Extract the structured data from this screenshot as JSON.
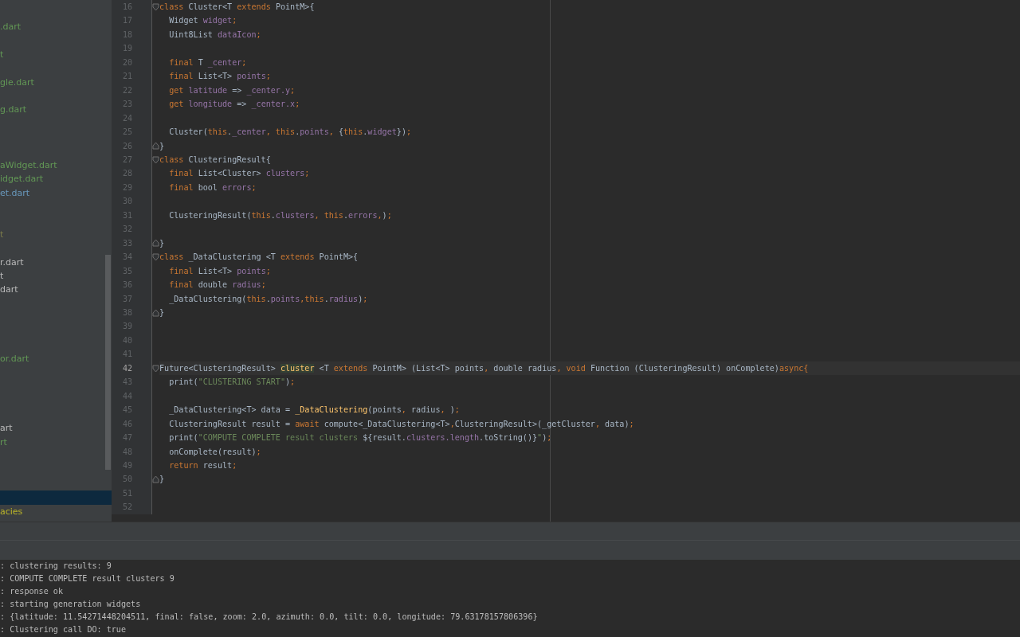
{
  "project_tree": {
    "items": [
      {
        "kind": "file",
        "label": ".dart",
        "color": "#629755",
        "selected": false
      },
      {
        "kind": "blank",
        "selected": false
      },
      {
        "kind": "file",
        "label": "t",
        "color": "#629755",
        "selected": false
      },
      {
        "kind": "blank",
        "selected": false
      },
      {
        "kind": "file",
        "label": "gle.dart",
        "color": "#629755",
        "selected": false
      },
      {
        "kind": "blank",
        "selected": false
      },
      {
        "kind": "file",
        "label": "g.dart",
        "color": "#629755",
        "selected": false
      },
      {
        "kind": "blank",
        "selected": false
      },
      {
        "kind": "blank",
        "selected": false
      },
      {
        "kind": "blank",
        "selected": false
      },
      {
        "kind": "file",
        "label": "aWidget.dart",
        "color": "#629755",
        "selected": false
      },
      {
        "kind": "file",
        "label": "idget.dart",
        "color": "#629755",
        "selected": false
      },
      {
        "kind": "file",
        "label": "et.dart",
        "color": "#6897bb",
        "selected": false
      },
      {
        "kind": "blank",
        "selected": false
      },
      {
        "kind": "blank",
        "selected": false
      },
      {
        "kind": "file",
        "label": "t",
        "color": "#7b7b4a",
        "selected": false
      },
      {
        "kind": "blank",
        "selected": false
      },
      {
        "kind": "file",
        "label": "r.dart",
        "color": "#bbbbbb",
        "selected": false
      },
      {
        "kind": "file",
        "label": "t",
        "color": "#bbbbbb",
        "selected": false
      },
      {
        "kind": "file",
        "label": "dart",
        "color": "#bbbbbb",
        "selected": false
      },
      {
        "kind": "blank",
        "selected": false
      },
      {
        "kind": "blank",
        "selected": false
      },
      {
        "kind": "blank",
        "selected": false
      },
      {
        "kind": "blank",
        "selected": false
      },
      {
        "kind": "file",
        "label": "or.dart",
        "color": "#629755",
        "selected": false
      },
      {
        "kind": "blank",
        "selected": false
      },
      {
        "kind": "blank",
        "selected": false
      },
      {
        "kind": "blank",
        "selected": false
      },
      {
        "kind": "blank",
        "selected": false
      },
      {
        "kind": "file",
        "label": "art",
        "color": "#bbbbbb",
        "selected": false
      },
      {
        "kind": "file",
        "label": "rt",
        "color": "#629755",
        "selected": false
      },
      {
        "kind": "blank",
        "selected": false
      },
      {
        "kind": "blank",
        "selected": false
      },
      {
        "kind": "blank",
        "selected": false
      },
      {
        "kind": "blank",
        "selected": true
      },
      {
        "kind": "file",
        "label": "acies",
        "color": "#bbb529",
        "selected": false
      }
    ]
  },
  "editor": {
    "lines": [
      {
        "number": "16",
        "fold_start": true,
        "current": false,
        "tokens": [
          {
            "kind": "keyword",
            "text": "class "
          },
          {
            "kind": "plain",
            "text": "Cluster<T "
          },
          {
            "kind": "keyword",
            "text": "extends "
          },
          {
            "kind": "plain",
            "text": "PointM>{"
          }
        ]
      },
      {
        "number": "17",
        "current": false,
        "tokens": [
          {
            "kind": "plain",
            "text": "  Widget "
          },
          {
            "kind": "field",
            "text": "widget"
          },
          {
            "kind": "keyword",
            "text": ";"
          }
        ]
      },
      {
        "number": "18",
        "current": false,
        "tokens": [
          {
            "kind": "plain",
            "text": "  Uint8List "
          },
          {
            "kind": "field",
            "text": "dataIcon"
          },
          {
            "kind": "keyword",
            "text": ";"
          }
        ]
      },
      {
        "number": "19",
        "current": false
      },
      {
        "number": "20",
        "current": false,
        "tokens": [
          {
            "kind": "keyword",
            "text": "  final "
          },
          {
            "kind": "plain",
            "text": "T "
          },
          {
            "kind": "field",
            "text": "_center"
          },
          {
            "kind": "keyword",
            "text": ";"
          }
        ]
      },
      {
        "number": "21",
        "current": false,
        "tokens": [
          {
            "kind": "keyword",
            "text": "  final "
          },
          {
            "kind": "plain",
            "text": "List<T> "
          },
          {
            "kind": "field",
            "text": "points"
          },
          {
            "kind": "keyword",
            "text": ";"
          }
        ]
      },
      {
        "number": "22",
        "current": false,
        "tokens": [
          {
            "kind": "keyword",
            "text": "  get "
          },
          {
            "kind": "field",
            "text": "latitude"
          },
          {
            "kind": "plain",
            "text": " => "
          },
          {
            "kind": "field",
            "text": "_center.y"
          },
          {
            "kind": "keyword",
            "text": ";"
          }
        ]
      },
      {
        "number": "23",
        "current": false,
        "tokens": [
          {
            "kind": "keyword",
            "text": "  get "
          },
          {
            "kind": "field",
            "text": "longitude"
          },
          {
            "kind": "plain",
            "text": " => "
          },
          {
            "kind": "field",
            "text": "_center.x"
          },
          {
            "kind": "keyword",
            "text": ";"
          }
        ]
      },
      {
        "number": "24",
        "current": false
      },
      {
        "number": "25",
        "current": false,
        "tokens": [
          {
            "kind": "plain",
            "text": "  Cluster("
          },
          {
            "kind": "keyword",
            "text": "this"
          },
          {
            "kind": "plain",
            "text": "."
          },
          {
            "kind": "field",
            "text": "_center"
          },
          {
            "kind": "keyword",
            "text": ", this"
          },
          {
            "kind": "plain",
            "text": "."
          },
          {
            "kind": "field",
            "text": "points"
          },
          {
            "kind": "keyword",
            "text": ", "
          },
          {
            "kind": "plain",
            "text": "{"
          },
          {
            "kind": "keyword",
            "text": "this"
          },
          {
            "kind": "plain",
            "text": "."
          },
          {
            "kind": "field",
            "text": "widget"
          },
          {
            "kind": "plain",
            "text": "})"
          },
          {
            "kind": "keyword",
            "text": ";"
          }
        ]
      },
      {
        "number": "26",
        "fold_end": true,
        "current": false,
        "tokens": [
          {
            "kind": "plain",
            "text": "}"
          }
        ]
      },
      {
        "number": "27",
        "fold_start": true,
        "current": false,
        "tokens": [
          {
            "kind": "keyword",
            "text": "class "
          },
          {
            "kind": "plain",
            "text": "ClusteringResult{"
          }
        ]
      },
      {
        "number": "28",
        "current": false,
        "tokens": [
          {
            "kind": "keyword",
            "text": "  final "
          },
          {
            "kind": "plain",
            "text": "List<Cluster> "
          },
          {
            "kind": "field",
            "text": "clusters"
          },
          {
            "kind": "keyword",
            "text": ";"
          }
        ]
      },
      {
        "number": "29",
        "current": false,
        "tokens": [
          {
            "kind": "keyword",
            "text": "  final "
          },
          {
            "kind": "plain",
            "text": "bool "
          },
          {
            "kind": "field",
            "text": "errors"
          },
          {
            "kind": "keyword",
            "text": ";"
          }
        ]
      },
      {
        "number": "30",
        "current": false
      },
      {
        "number": "31",
        "current": false,
        "tokens": [
          {
            "kind": "plain",
            "text": "  ClusteringResult("
          },
          {
            "kind": "keyword",
            "text": "this"
          },
          {
            "kind": "plain",
            "text": "."
          },
          {
            "kind": "field",
            "text": "clusters"
          },
          {
            "kind": "keyword",
            "text": ", this"
          },
          {
            "kind": "plain",
            "text": "."
          },
          {
            "kind": "field",
            "text": "errors"
          },
          {
            "kind": "keyword",
            "text": ","
          },
          {
            "kind": "plain",
            "text": ")"
          },
          {
            "kind": "keyword",
            "text": ";"
          }
        ]
      },
      {
        "number": "32",
        "current": false
      },
      {
        "number": "33",
        "fold_end": true,
        "current": false,
        "tokens": [
          {
            "kind": "plain",
            "text": "}"
          }
        ]
      },
      {
        "number": "34",
        "fold_start": true,
        "current": false,
        "tokens": [
          {
            "kind": "keyword",
            "text": "class "
          },
          {
            "kind": "plain",
            "text": "_DataClustering <T "
          },
          {
            "kind": "keyword",
            "text": "extends "
          },
          {
            "kind": "plain",
            "text": "PointM>{"
          }
        ]
      },
      {
        "number": "35",
        "current": false,
        "tokens": [
          {
            "kind": "keyword",
            "text": "  final "
          },
          {
            "kind": "plain",
            "text": "List<T> "
          },
          {
            "kind": "field",
            "text": "points"
          },
          {
            "kind": "keyword",
            "text": ";"
          }
        ]
      },
      {
        "number": "36",
        "current": false,
        "tokens": [
          {
            "kind": "keyword",
            "text": "  final "
          },
          {
            "kind": "plain",
            "text": "double "
          },
          {
            "kind": "field",
            "text": "radius"
          },
          {
            "kind": "keyword",
            "text": ";"
          }
        ]
      },
      {
        "number": "37",
        "current": false,
        "tokens": [
          {
            "kind": "plain",
            "text": "  _DataClustering("
          },
          {
            "kind": "keyword",
            "text": "this"
          },
          {
            "kind": "plain",
            "text": "."
          },
          {
            "kind": "field",
            "text": "points"
          },
          {
            "kind": "keyword",
            "text": ",this"
          },
          {
            "kind": "plain",
            "text": "."
          },
          {
            "kind": "field",
            "text": "radius"
          },
          {
            "kind": "plain",
            "text": ")"
          },
          {
            "kind": "keyword",
            "text": ";"
          }
        ]
      },
      {
        "number": "38",
        "fold_end": true,
        "current": false,
        "tokens": [
          {
            "kind": "plain",
            "text": "}"
          }
        ]
      },
      {
        "number": "39",
        "current": false
      },
      {
        "number": "40",
        "current": false
      },
      {
        "number": "41",
        "current": false
      },
      {
        "number": "42",
        "fold_start": true,
        "current": true,
        "tokens": [
          {
            "kind": "plain",
            "text": "Future<ClusteringResult> "
          },
          {
            "kind": "highlight",
            "text": "cluster"
          },
          {
            "kind": "plain",
            "text": " <T "
          },
          {
            "kind": "keyword",
            "text": "extends "
          },
          {
            "kind": "plain",
            "text": "PointM> (List<T> points"
          },
          {
            "kind": "keyword",
            "text": ", "
          },
          {
            "kind": "plain",
            "text": "double radius"
          },
          {
            "kind": "keyword",
            "text": ", void "
          },
          {
            "kind": "plain",
            "text": "Function (ClusteringResult) onComplete)"
          },
          {
            "kind": "keyword",
            "text": "async{"
          }
        ]
      },
      {
        "number": "43",
        "current": false,
        "tokens": [
          {
            "kind": "plain",
            "text": "  print("
          },
          {
            "kind": "string",
            "text": "\"CLUSTERING START\""
          },
          {
            "kind": "plain",
            "text": ")"
          },
          {
            "kind": "keyword",
            "text": ";"
          }
        ]
      },
      {
        "number": "44",
        "current": false
      },
      {
        "number": "45",
        "current": false,
        "tokens": [
          {
            "kind": "plain",
            "text": "  _DataClustering<T> data = "
          },
          {
            "kind": "method",
            "text": "_DataClustering"
          },
          {
            "kind": "plain",
            "text": "(points"
          },
          {
            "kind": "keyword",
            "text": ", "
          },
          {
            "kind": "plain",
            "text": "radius"
          },
          {
            "kind": "keyword",
            "text": ", "
          },
          {
            "kind": "plain",
            "text": ")"
          },
          {
            "kind": "keyword",
            "text": ";"
          }
        ]
      },
      {
        "number": "46",
        "current": false,
        "tokens": [
          {
            "kind": "plain",
            "text": "  ClusteringResult result = "
          },
          {
            "kind": "keyword",
            "text": "await "
          },
          {
            "kind": "plain",
            "text": "compute<_DataClustering<T>"
          },
          {
            "kind": "keyword",
            "text": ","
          },
          {
            "kind": "plain",
            "text": "ClusteringResult>(_getCluster"
          },
          {
            "kind": "keyword",
            "text": ", "
          },
          {
            "kind": "plain",
            "text": "data)"
          },
          {
            "kind": "keyword",
            "text": ";"
          }
        ]
      },
      {
        "number": "47",
        "current": false,
        "tokens": [
          {
            "kind": "plain",
            "text": "  print("
          },
          {
            "kind": "string",
            "text": "\"COMPUTE COMPLETE result clusters "
          },
          {
            "kind": "plain",
            "text": "${result."
          },
          {
            "kind": "field",
            "text": "clusters.length"
          },
          {
            "kind": "plain",
            "text": ".toString()}"
          },
          {
            "kind": "string",
            "text": "\""
          },
          {
            "kind": "plain",
            "text": ")"
          },
          {
            "kind": "keyword",
            "text": ";"
          }
        ]
      },
      {
        "number": "48",
        "current": false,
        "tokens": [
          {
            "kind": "plain",
            "text": "  onComplete(result)"
          },
          {
            "kind": "keyword",
            "text": ";"
          }
        ]
      },
      {
        "number": "49",
        "current": false,
        "tokens": [
          {
            "kind": "keyword",
            "text": "  return "
          },
          {
            "kind": "plain",
            "text": "result"
          },
          {
            "kind": "keyword",
            "text": ";"
          }
        ]
      },
      {
        "number": "50",
        "fold_end": true,
        "current": false,
        "tokens": [
          {
            "kind": "plain",
            "text": "}"
          }
        ]
      },
      {
        "number": "51",
        "current": false
      },
      {
        "number": "52",
        "current": false
      }
    ]
  },
  "console": {
    "lines": [
      ": clustering results: 9",
      ": COMPUTE COMPLETE result clusters 9",
      ": response ok",
      ": starting generation widgets",
      ": {latitude: 11.54271448204511, final: false, zoom: 2.0, azimuth: 0.0, tilt: 0.0, longitude: 79.63178157806396}",
      ": Clustering call DO: true"
    ]
  }
}
